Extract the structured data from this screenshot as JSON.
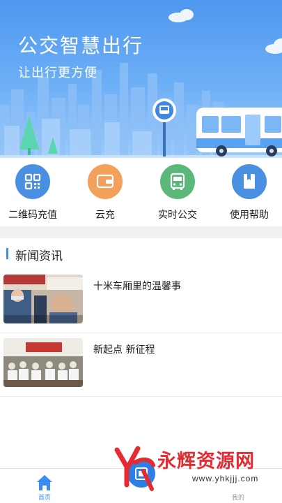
{
  "banner": {
    "title": "公交智慧出行",
    "subtitle": "让出行更方便"
  },
  "actions": [
    {
      "label": "二维码充值",
      "icon": "qr-code-icon",
      "color": "#4a90e2"
    },
    {
      "label": "云充",
      "icon": "wallet-icon",
      "color": "#f2a05a"
    },
    {
      "label": "实时公交",
      "icon": "bus-icon",
      "color": "#5cb87a"
    },
    {
      "label": "使用帮助",
      "icon": "help-book-icon",
      "color": "#4a90e2"
    }
  ],
  "news": {
    "title": "新闻资讯",
    "items": [
      {
        "headline": "十米车厢里的温馨事"
      },
      {
        "headline": "新起点 新征程"
      }
    ]
  },
  "bottom_nav": {
    "home_label": "首页",
    "mine_label": "我的",
    "accent": "#3a8cf5"
  },
  "watermark": {
    "text": "永辉资源网",
    "url": "www.yhkjjj.com"
  }
}
